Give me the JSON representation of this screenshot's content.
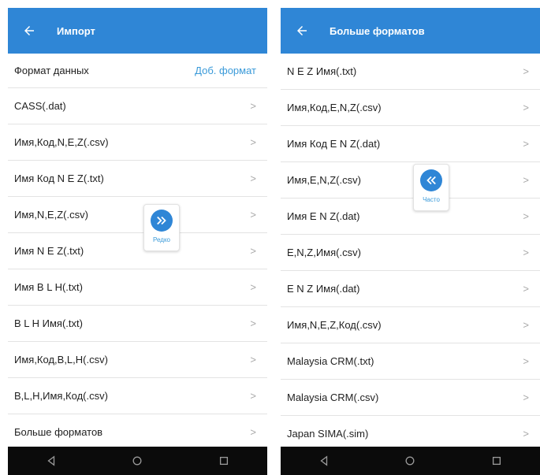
{
  "colors": {
    "header": "#2f86d6",
    "link": "#3a9ad9",
    "navbar": "#0b0b0b"
  },
  "left": {
    "title": "Импорт",
    "format_label": "Формат данных",
    "add_format": "Доб. формат",
    "items": [
      "CASS(.dat)",
      "Имя,Код,N,E,Z(.csv)",
      "Имя Код N E Z(.txt)",
      "Имя,N,E,Z(.csv)",
      "Имя N E Z(.txt)",
      "Имя B L H(.txt)",
      "B L H Имя(.txt)",
      "Имя,Код,B,L,H(.csv)",
      "B,L,H,Имя,Код(.csv)",
      "Больше форматов"
    ],
    "fab_label": "Редко",
    "fab_icon": "double-chevron-right-icon"
  },
  "right": {
    "title": "Больше форматов",
    "items": [
      "N E Z Имя(.txt)",
      "Имя,Код,E,N,Z(.csv)",
      "Имя Код E N Z(.dat)",
      "Имя,E,N,Z(.csv)",
      "Имя E N Z(.dat)",
      "E,N,Z,Имя(.csv)",
      "E N Z Имя(.dat)",
      "Имя,N,E,Z,Код(.csv)",
      "Malaysia CRM(.txt)",
      "Malaysia CRM(.csv)",
      "Japan SIMA(.sim)"
    ],
    "fab_label": "Часто",
    "fab_icon": "double-chevron-left-icon"
  },
  "chevron": ">",
  "navbar": [
    "back-triangle-icon",
    "home-circle-icon",
    "recents-square-icon"
  ]
}
